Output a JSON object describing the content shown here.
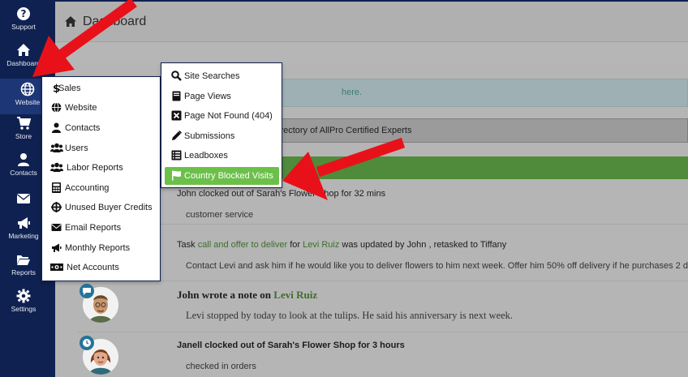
{
  "sidebar": {
    "items": [
      {
        "label": "Support",
        "icon": "question-circle-icon"
      },
      {
        "label": "Dashboard",
        "icon": "home-icon"
      },
      {
        "label": "Website",
        "icon": "globe-icon"
      },
      {
        "label": "Store",
        "icon": "cart-icon"
      },
      {
        "label": "Contacts",
        "icon": "user-icon"
      },
      {
        "label": "",
        "icon": "envelope-icon"
      },
      {
        "label": "Marketing",
        "icon": "megaphone-icon"
      },
      {
        "label": "Reports",
        "icon": "folder-open-icon"
      },
      {
        "label": "Settings",
        "icon": "gear-icon"
      }
    ]
  },
  "header": {
    "title": "Dashboard"
  },
  "info_bar": {
    "link_text": "here."
  },
  "notice_bar": {
    "text": "irectory of AllPro Certified Experts"
  },
  "menu": {
    "items": [
      {
        "label": "Sales",
        "icon": "dollar-icon"
      },
      {
        "label": "Website",
        "icon": "globe-icon"
      },
      {
        "label": "Contacts",
        "icon": "user-icon"
      },
      {
        "label": "Users",
        "icon": "users-icon"
      },
      {
        "label": "Labor Reports",
        "icon": "users-icon"
      },
      {
        "label": "Accounting",
        "icon": "calculator-icon"
      },
      {
        "label": "Unused Buyer Credits",
        "icon": "crosshair-icon"
      },
      {
        "label": "Email Reports",
        "icon": "envelope-icon"
      },
      {
        "label": "Monthly Reports",
        "icon": "megaphone-icon"
      },
      {
        "label": "Net Accounts",
        "icon": "money-icon"
      }
    ]
  },
  "submenu": {
    "items": [
      {
        "label": "Site Searches",
        "icon": "search-icon"
      },
      {
        "label": "Page Views",
        "icon": "book-icon"
      },
      {
        "label": "Page Not Found (404)",
        "icon": "close-box-icon"
      },
      {
        "label": "Submissions",
        "icon": "pencil-icon"
      },
      {
        "label": "Leadboxes",
        "icon": "list-icon"
      },
      {
        "label": "Country Blocked Visits",
        "icon": "flag-icon"
      }
    ]
  },
  "feed": [
    {
      "head": "John clocked out of Sarah's Flower Shop for 32 mins",
      "body": "customer service"
    },
    {
      "head_prefix": "Task ",
      "head_link": "call and offer to deliver",
      "head_mid": " for ",
      "head_person": "Levi Ruiz",
      "head_suffix": " was updated by John , retasked to Tiffany",
      "body": "Contact Levi and ask him if he would like you to deliver flowers to him next week.  Offer him 50% off delivery if he purchases 2 d"
    },
    {
      "head_prefix": "John wrote a note on ",
      "head_person": "Levi Ruiz",
      "body": "Levi stopped by today to look at the tulips. He said his anniversary is next week."
    },
    {
      "head": "Janell clocked out of Sarah's Flower Shop for 3 hours",
      "body": "checked in orders"
    }
  ],
  "colors": {
    "rail": "#0f2150",
    "highlight": "#6cc04a",
    "arrow": "#e8111a",
    "link": "#3f6e2a"
  }
}
